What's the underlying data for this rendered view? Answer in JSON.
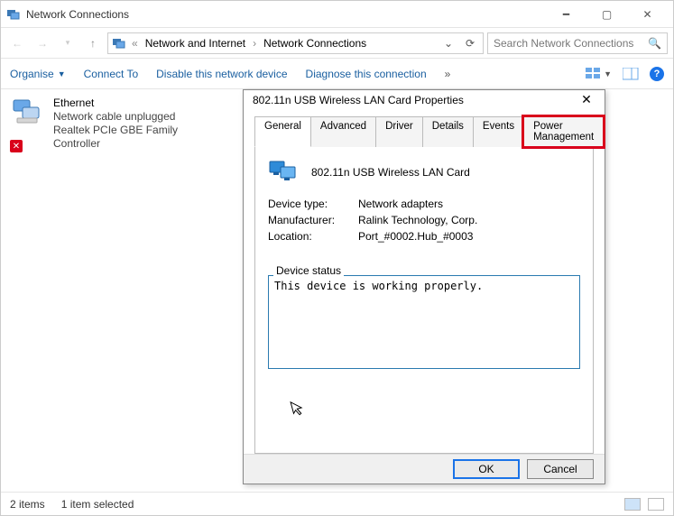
{
  "window": {
    "title": "Network Connections"
  },
  "breadcrumb": {
    "parts": [
      "Network and Internet",
      "Network Connections"
    ]
  },
  "search": {
    "placeholder": "Search Network Connections"
  },
  "toolbar": {
    "organise": "Organise",
    "connect": "Connect To",
    "disable": "Disable this network device",
    "diagnose": "Diagnose this connection"
  },
  "adapter": {
    "name": "Ethernet",
    "status": "Network cable unplugged",
    "device": "Realtek PCIe GBE Family Controller"
  },
  "dialog": {
    "title": "802.11n USB Wireless LAN Card Properties",
    "tabs": [
      "General",
      "Advanced",
      "Driver",
      "Details",
      "Events",
      "Power Management"
    ],
    "device_name": "802.11n USB Wireless LAN Card",
    "kv": {
      "type_label": "Device type:",
      "type_value": "Network adapters",
      "manuf_label": "Manufacturer:",
      "manuf_value": "Ralink Technology, Corp.",
      "loc_label": "Location:",
      "loc_value": "Port_#0002.Hub_#0003"
    },
    "status_label": "Device status",
    "status_text": "This device is working properly.",
    "ok": "OK",
    "cancel": "Cancel"
  },
  "statusbar": {
    "count": "2 items",
    "selected": "1 item selected"
  }
}
